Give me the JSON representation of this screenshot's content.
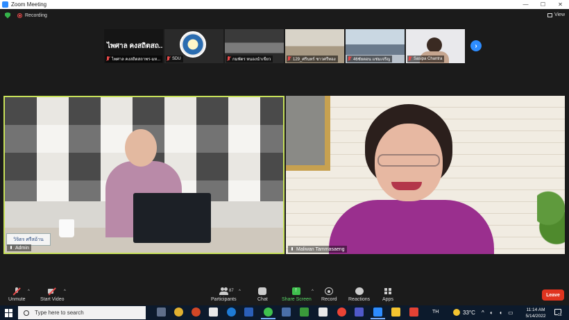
{
  "window": {
    "title": "Zoom Meeting",
    "controls": {
      "minimize": "—",
      "maximize": "☐",
      "close": "✕"
    }
  },
  "status": {
    "recording_label": "Recording",
    "view_label": "View"
  },
  "thumbnails": [
    {
      "name": "ไพศาล คงสถิตสถาพร-มห...",
      "big_text": "ไพศาล คงสถิตสถ..."
    },
    {
      "name": "SDU"
    },
    {
      "name": "กมพัตร หนองนำเขียว"
    },
    {
      "name": "129_ศรินทร์ ชาวศรีทอง"
    },
    {
      "name": "46ชัยตอน แช่มเจริญ"
    },
    {
      "name": "Sasipa Chantra"
    }
  ],
  "next_page_icon": "›",
  "main_videos": {
    "left": {
      "name": "Admin",
      "nameplate": "วิจิตร ศรีสอ้าน"
    },
    "right": {
      "name": "Maliwan Tammasaeng"
    }
  },
  "toolbar": {
    "unmute": "Unmute",
    "start_video": "Start Video",
    "participants": "Participants",
    "participants_count": "87",
    "chat": "Chat",
    "share_screen": "Share Screen",
    "record": "Record",
    "reactions": "Reactions",
    "apps": "Apps",
    "leave": "Leave",
    "caret": "^"
  },
  "taskbar": {
    "search_placeholder": "Type here to search",
    "language": "TH",
    "temperature": "33°C",
    "time": "11:14 AM",
    "date": "5/14/2022",
    "notification_count": "16"
  },
  "colors": {
    "active_speaker_border": "#c8e25a",
    "leave_button": "#e0341f",
    "share_screen": "#3fc14e",
    "zoom_blue": "#2d8cff"
  }
}
